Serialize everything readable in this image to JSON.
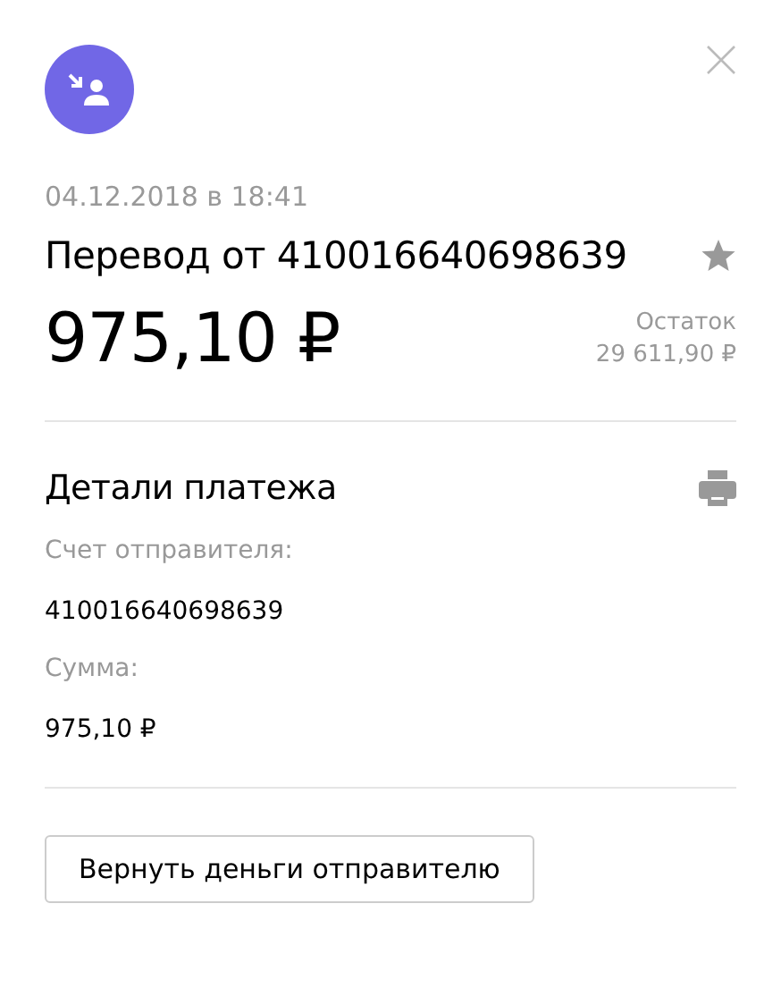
{
  "date": "04.12.2018 в 18:41",
  "title": "Перевод от 410016640698639",
  "amount": "975,10 ₽",
  "balance": {
    "label": "Остаток",
    "value": "29 611,90 ₽"
  },
  "details": {
    "title": "Детали платежа",
    "fields": [
      {
        "label": "Счет отправителя:",
        "value": "410016640698639"
      },
      {
        "label": "Сумма:",
        "value": "975,10 ₽"
      }
    ]
  },
  "buttons": [
    "Вернуть деньги отправителю"
  ]
}
